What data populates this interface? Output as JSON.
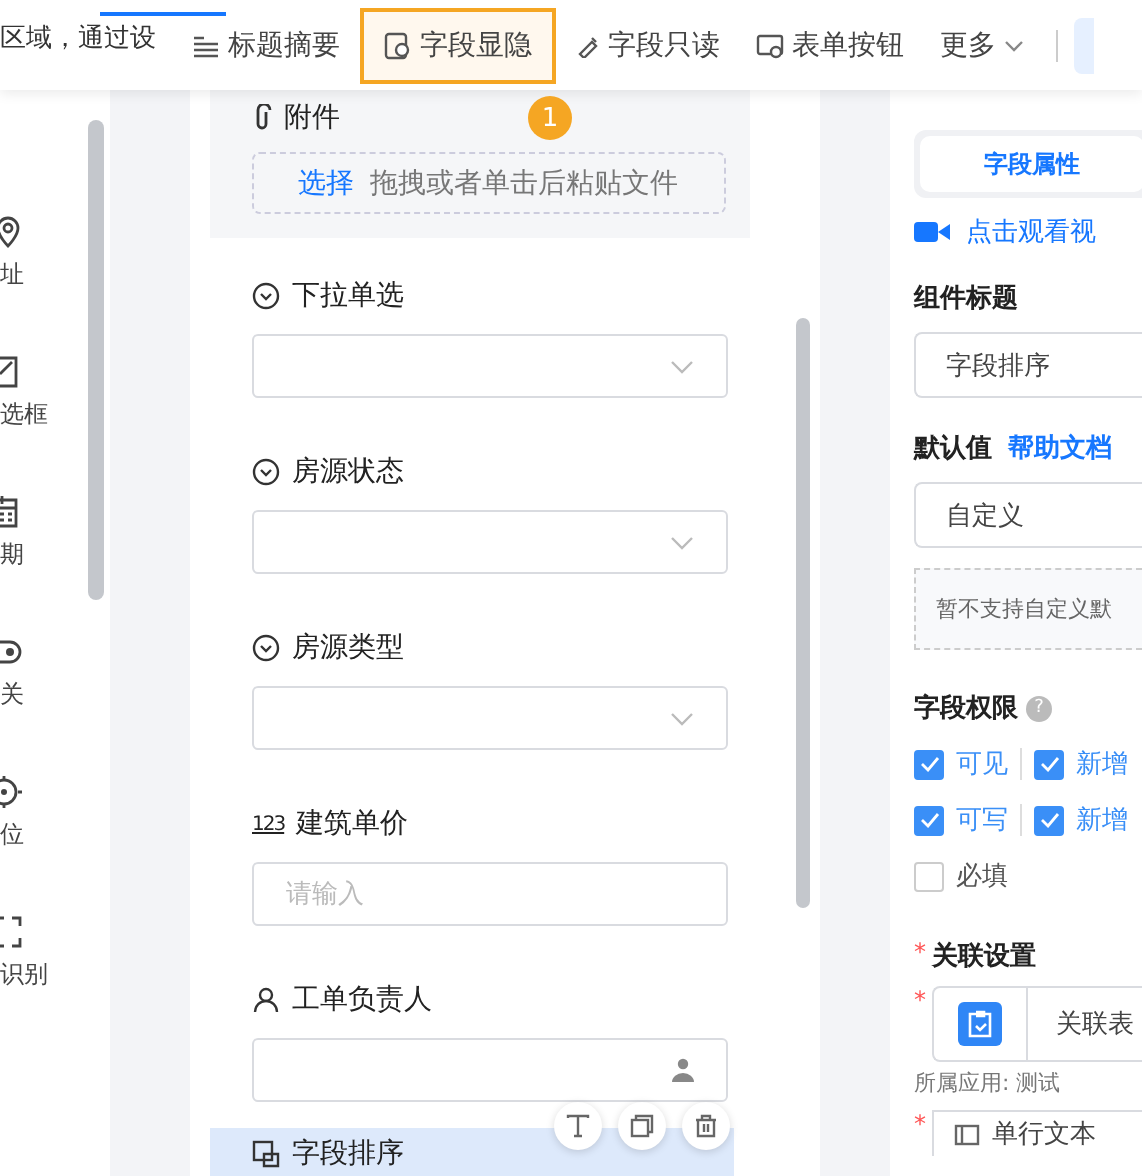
{
  "toolbar": {
    "hint": "区域，通过设",
    "items": [
      {
        "label": "标题摘要",
        "selected": false
      },
      {
        "label": "字段显隐",
        "selected": true
      },
      {
        "label": "字段只读",
        "selected": false
      },
      {
        "label": "表单按钮",
        "selected": false
      }
    ],
    "more": "更多",
    "step_badge": "1"
  },
  "sidebar": {
    "items": [
      {
        "label": "址"
      },
      {
        "label": "选框"
      },
      {
        "label": "期"
      },
      {
        "label": "关"
      },
      {
        "label": "位"
      },
      {
        "label": "识别"
      }
    ]
  },
  "canvas": {
    "attachment": {
      "label": "附件",
      "pick": "选择",
      "hint": "拖拽或者单击后粘贴文件"
    },
    "fields": [
      {
        "kind": "select",
        "label": "下拉单选"
      },
      {
        "kind": "select",
        "label": "房源状态"
      },
      {
        "kind": "select",
        "label": "房源类型"
      },
      {
        "kind": "number",
        "label": "建筑单价",
        "placeholder": "请输入",
        "icon_text": "123"
      },
      {
        "kind": "user",
        "label": "工单负责人"
      }
    ],
    "selected_field": {
      "label": "字段排序"
    }
  },
  "panel": {
    "tab": "字段属性",
    "video_link": "点击观看视",
    "title_label": "组件标题",
    "title_value": "字段排序",
    "default_label": "默认值",
    "help_link": "帮助文档",
    "default_value": "自定义",
    "default_note": "暂不支持自定义默",
    "permissions_label": "字段权限",
    "help_mark": "?",
    "required_marks": [
      "*",
      "*",
      "*"
    ],
    "permissions": [
      [
        {
          "label": "可见",
          "checked": true
        },
        {
          "label": "新增",
          "checked": true
        }
      ],
      [
        {
          "label": "可写",
          "checked": true
        },
        {
          "label": "新增",
          "checked": true
        }
      ],
      [
        {
          "label": "必填",
          "checked": false
        }
      ]
    ],
    "relation_label": "关联设置",
    "relation_value": "关联表",
    "relation_app": "所属应用: 测试",
    "field_value": "单行文本"
  }
}
